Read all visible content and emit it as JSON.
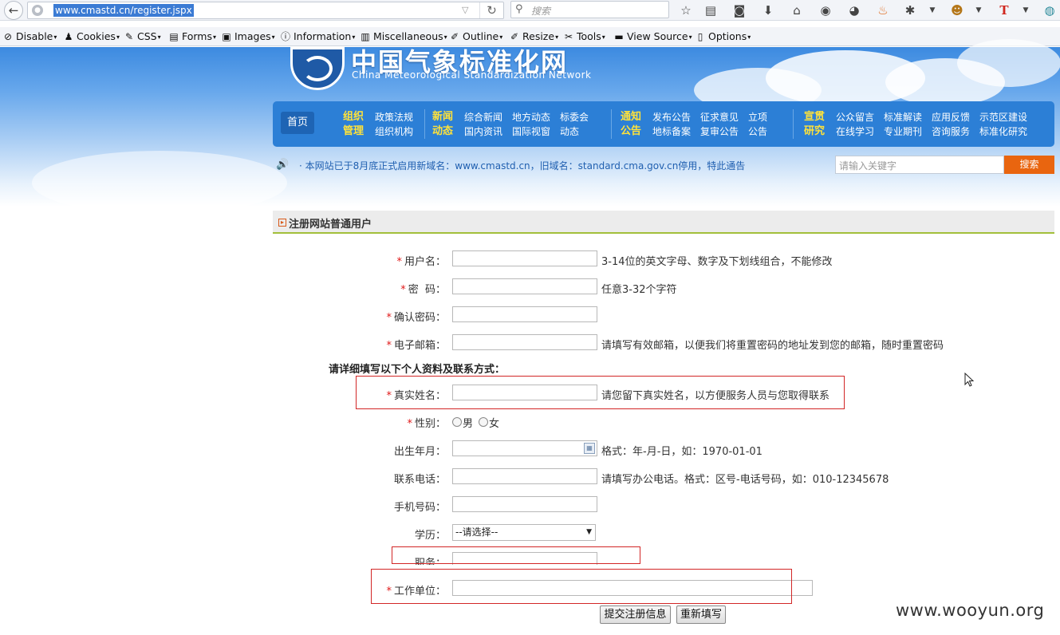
{
  "browser": {
    "back_glyph": "←",
    "url": "www.cmastd.cn/register.jspx",
    "search_placeholder": "搜索",
    "toolbar_icons": [
      "star-icon",
      "reading-list-icon",
      "pocket-icon",
      "download-icon",
      "home-icon",
      "chat-icon",
      "chat-bubble-icon",
      "flame-icon",
      "bug-icon",
      "monkey-icon",
      "text-t-icon",
      "globe-icon"
    ]
  },
  "webdev": {
    "items": [
      {
        "label": "Disable",
        "icon": "⊘"
      },
      {
        "label": "Cookies",
        "icon": "♟"
      },
      {
        "label": "CSS",
        "icon": "✎"
      },
      {
        "label": "Forms",
        "icon": "▤"
      },
      {
        "label": "Images",
        "icon": "▣"
      },
      {
        "label": "Information",
        "icon": "ⓘ"
      },
      {
        "label": "Miscellaneous",
        "icon": "▥"
      },
      {
        "label": "Outline",
        "icon": "✐"
      },
      {
        "label": "Resize",
        "icon": "✐"
      },
      {
        "label": "Tools",
        "icon": "✂"
      },
      {
        "label": "View Source",
        "icon": "▬"
      },
      {
        "label": "Options",
        "icon": "▯"
      }
    ]
  },
  "header": {
    "title_cn": "中国气象标准化网",
    "title_en": "China Meteorological Standardization Network"
  },
  "nav": {
    "home": "首页",
    "groups": [
      {
        "cat": [
          "组织",
          "管理"
        ],
        "links": [
          [
            "政策法规"
          ],
          [
            "组织机构"
          ]
        ]
      },
      {
        "cat": [
          "新闻",
          "动态"
        ],
        "links": [
          [
            "综合新闻",
            "地方动态",
            "标委会"
          ],
          [
            "国内资讯",
            "国际视窗",
            "动态"
          ]
        ]
      },
      {
        "cat": [
          "通知",
          "公告"
        ],
        "links": [
          [
            "发布公告",
            "征求意见",
            "立项"
          ],
          [
            "地标备案",
            "复审公告",
            "公告"
          ]
        ]
      },
      {
        "cat": [
          "宣贯",
          "研究"
        ],
        "links": [
          [
            "公众留言",
            "标准解读",
            "应用反馈",
            "示范区建设"
          ],
          [
            "在线学习",
            "专业期刊",
            "咨询服务",
            "标准化研究"
          ]
        ]
      }
    ]
  },
  "notice": {
    "text": "本网站已于8月底正式启用新域名：www.cmastd.cn，旧域名：standard.cma.gov.cn停用，特此通告"
  },
  "search": {
    "placeholder": "请输入关键字",
    "button": "搜索"
  },
  "form": {
    "section_title": "注册网站普通用户",
    "subhead": "请详细填写以下个人资料及联系方式：",
    "required_mark": "*",
    "fields": {
      "username": {
        "label": "用户名：",
        "hint": "3-14位的英文字母、数字及下划线组合，不能修改"
      },
      "password": {
        "label": "密  码：",
        "hint": "任意3-32个字符"
      },
      "confirm": {
        "label": "确认密码：",
        "hint": ""
      },
      "email": {
        "label": "电子邮箱：",
        "hint": "请填写有效邮箱，以便我们将重置密码的地址发到您的邮箱，随时重置密码"
      },
      "realname": {
        "label": "真实姓名：",
        "hint": "请您留下真实姓名，以方便服务人员与您取得联系"
      },
      "gender": {
        "label": "性别：",
        "options": [
          "男",
          "女"
        ]
      },
      "birth": {
        "label": "出生年月：",
        "hint": "格式：年-月-日，如：1970-01-01"
      },
      "phone": {
        "label": "联系电话：",
        "hint": "请填写办公电话。格式：区号-电话号码，如：010-12345678"
      },
      "mobile": {
        "label": "手机号码："
      },
      "education": {
        "label": "学历：",
        "selected": "--请选择--"
      },
      "position": {
        "label": "职务："
      },
      "company": {
        "label": "工作单位："
      }
    },
    "buttons": {
      "submit": "提交注册信息",
      "reset": "重新填写"
    }
  },
  "watermark": "www.wooyun.org",
  "colors": {
    "nav_bg": "#2c7fd6",
    "nav_cat": "#ffe23a",
    "accent_orange": "#e9650f",
    "required_red": "#e01818",
    "highlight_box": "#d22626"
  }
}
